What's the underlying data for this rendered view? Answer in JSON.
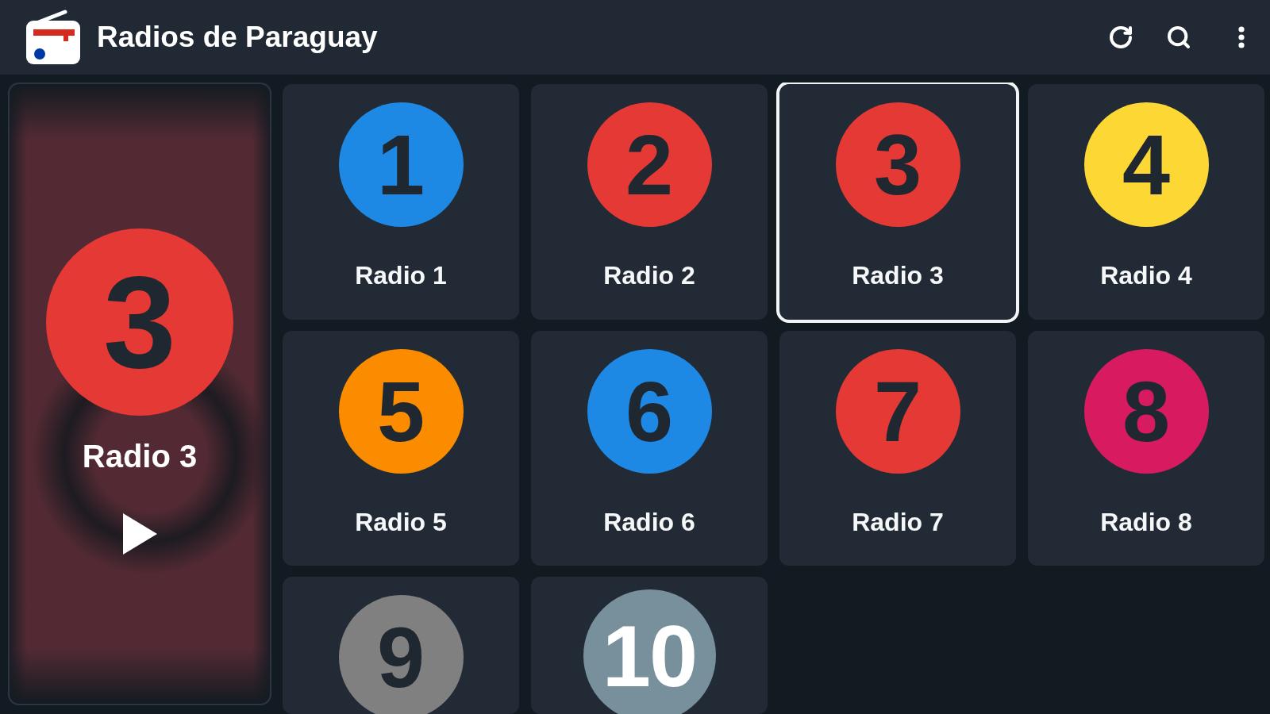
{
  "app_bar": {
    "title": "Radios de Paraguay"
  },
  "now_playing": {
    "logo": "3",
    "color": "#e53935",
    "title": "Radio 3",
    "playing": false
  },
  "stations": [
    {
      "logo": "1",
      "name": "Radio 1",
      "color": "#1e88e5",
      "kind": "dark",
      "selected": false
    },
    {
      "logo": "2",
      "name": "Radio 2",
      "color": "#e53935",
      "kind": "dark",
      "selected": false
    },
    {
      "logo": "3",
      "name": "Radio 3",
      "color": "#e53935",
      "kind": "dark",
      "selected": true
    },
    {
      "logo": "4",
      "name": "Radio 4",
      "color": "#fdd835",
      "kind": "dark",
      "selected": false
    },
    {
      "logo": "5",
      "name": "Radio 5",
      "color": "#fb8c00",
      "kind": "dark",
      "selected": false
    },
    {
      "logo": "6",
      "name": "Radio 6",
      "color": "#1e88e5",
      "kind": "dark",
      "selected": false
    },
    {
      "logo": "7",
      "name": "Radio 7",
      "color": "#e53935",
      "kind": "dark",
      "selected": false
    },
    {
      "logo": "8",
      "name": "Radio 8",
      "color": "#d81b60",
      "kind": "dark",
      "selected": false
    },
    {
      "logo": "9",
      "color": "#808080",
      "kind": "dark",
      "selected": false
    },
    {
      "logo": "10",
      "color": "#78909c",
      "kind": "light",
      "selected": false
    }
  ]
}
